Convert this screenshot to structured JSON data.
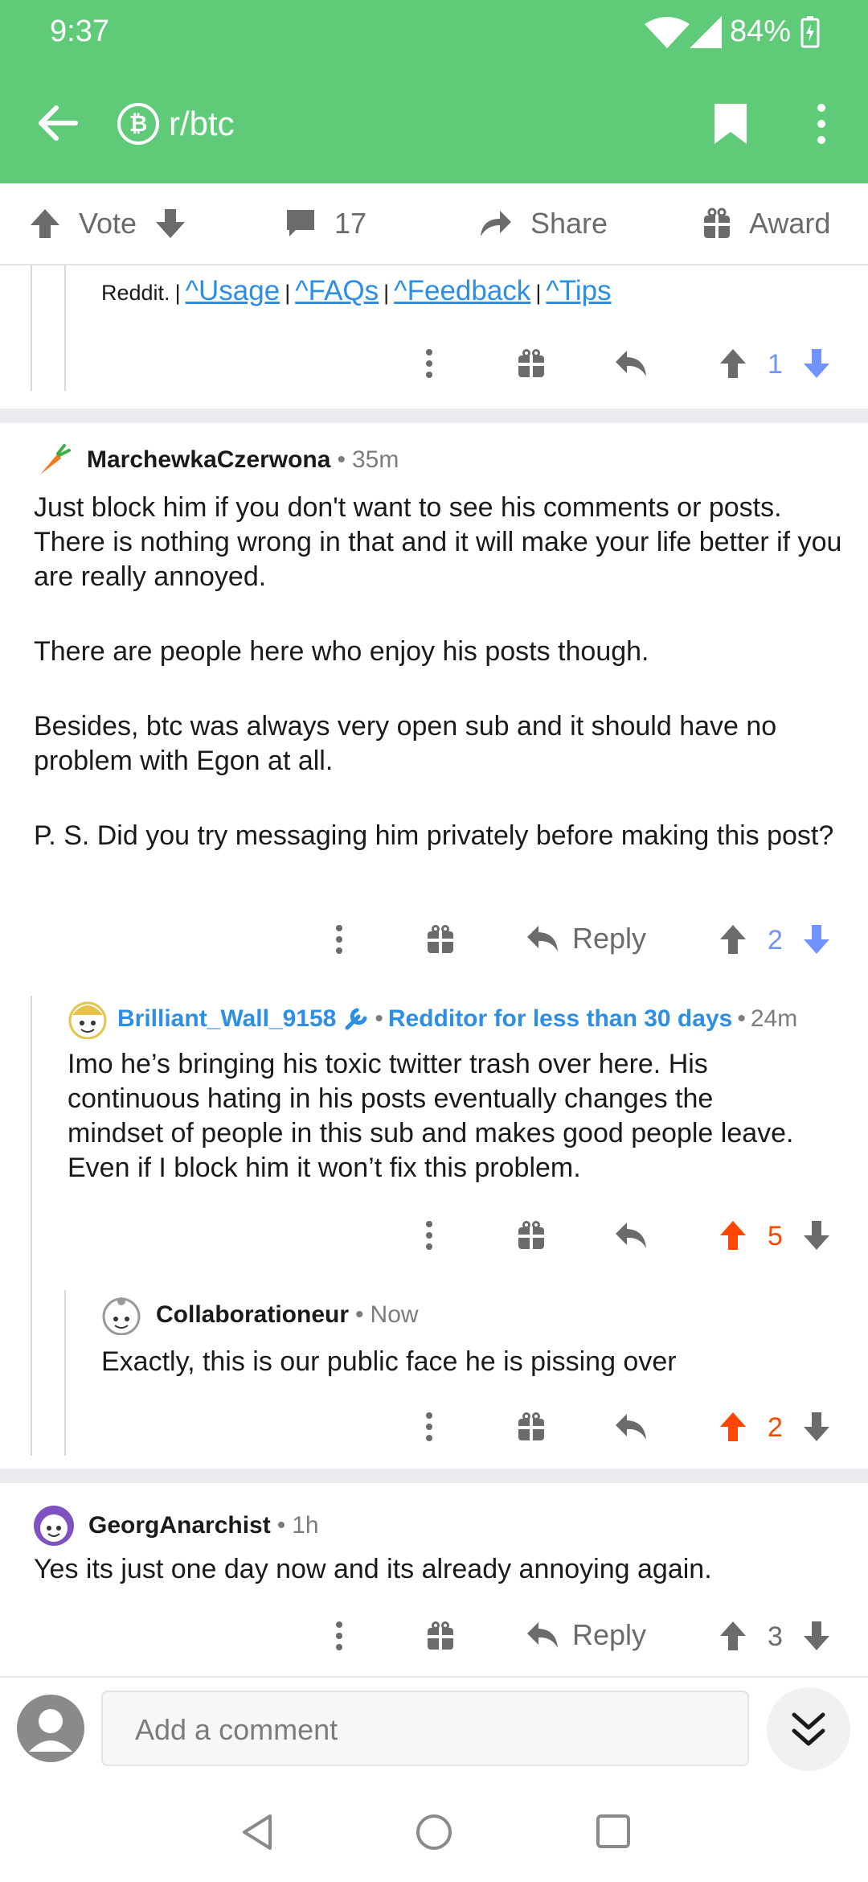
{
  "status": {
    "time": "9:37",
    "battery": "84%"
  },
  "app": {
    "subreddit": "r/btc"
  },
  "actions": {
    "vote": "Vote",
    "comments": "17",
    "share": "Share",
    "award": "Award"
  },
  "bot_footer": {
    "prefix": "Reddit.",
    "links": [
      "^Usage",
      "^FAQs",
      "^Feedback",
      "^Tips"
    ],
    "score": "1"
  },
  "comments": [
    {
      "user": "MarchewkaCzerwona",
      "time": "35m",
      "paragraphs": [
        "Just block him if you don't want to see his comments or posts. There is nothing wrong in that and it will make your life better if you are really annoyed.",
        "There are people here who enjoy his posts though.",
        "Besides, btc was always very open sub and it should have no problem with Egon at all.",
        "P. S. Did you try messaging him privately before making this post?"
      ],
      "reply_label": "Reply",
      "score": "2"
    },
    {
      "user": "Brilliant_Wall_9158",
      "flair": "Redditor for less than 30 days",
      "time": "24m",
      "body": "Imo he’s bringing his toxic twitter trash over here. His continuous hating in his posts eventually changes the mindset of people in this sub and makes good people leave. Even if I block him it won’t fix this problem.",
      "score": "5"
    },
    {
      "user": "Collaborationeur",
      "time": "Now",
      "body": "Exactly, this is our public face he is pissing over",
      "score": "2"
    },
    {
      "user": "GeorgAnarchist",
      "time": "1h",
      "body": "Yes its just one day now and its already annoying again.",
      "reply_label": "Reply",
      "score": "3"
    }
  ],
  "composer": {
    "placeholder": "Add a comment"
  },
  "separator": "•",
  "colors": {
    "header": "#5fcb78",
    "upvoted": "#ff4500",
    "downvote_active": "#7193ff",
    "link": "#2d8ee6"
  }
}
